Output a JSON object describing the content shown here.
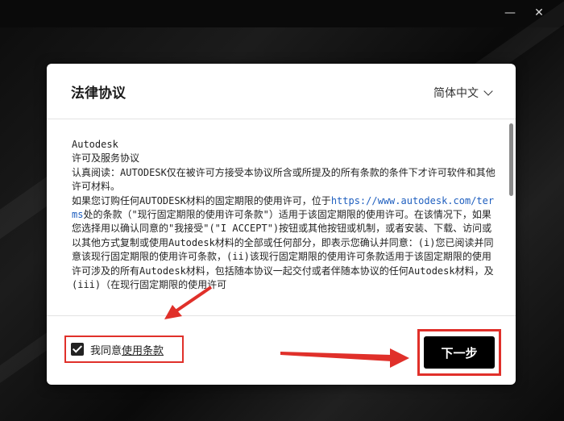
{
  "window": {
    "minimize_glyph": "—",
    "close_glyph": "✕"
  },
  "dialog": {
    "title": "法律协议",
    "language": "简体中文",
    "content_lines": [
      "Autodesk",
      "许可及服务协议",
      "认真阅读：AUTODESK仅在被许可方接受本协议所含或所提及的所有条款的条件下才许可软件和其他许可材料。",
      "如果您订购任何AUTODESK材料的固定期限的使用许可，位于"
    ],
    "content_link": "https://www.autodesk.com/terms",
    "content_after_link": "处的条款（\"现行固定期限的使用许可条款\"）适用于该固定期限的使用许可。在该情况下，如果您选择用以确认同意的\"我接受\"(\"I ACCEPT\")按钮或其他按钮或机制，或者安装、下载、访问或以其他方式复制或使用Autodesk材料的全部或任何部分，即表示您确认并同意：(i)您已阅读并同意该现行固定期限的使用许可条款，(ii)该现行固定期限的使用许可条款适用于该固定期限的使用许可涉及的所有Autodesk材料，包括随本协议一起交付或者伴随本协议的任何Autodesk材料，及(iii)（在现行固定期限的使用许可",
    "agree_prefix": "我同意",
    "agree_link": "使用条款",
    "next_label": "下一步"
  },
  "colors": {
    "annotation_red": "#e0302a",
    "link_blue": "#1f5fbf"
  }
}
